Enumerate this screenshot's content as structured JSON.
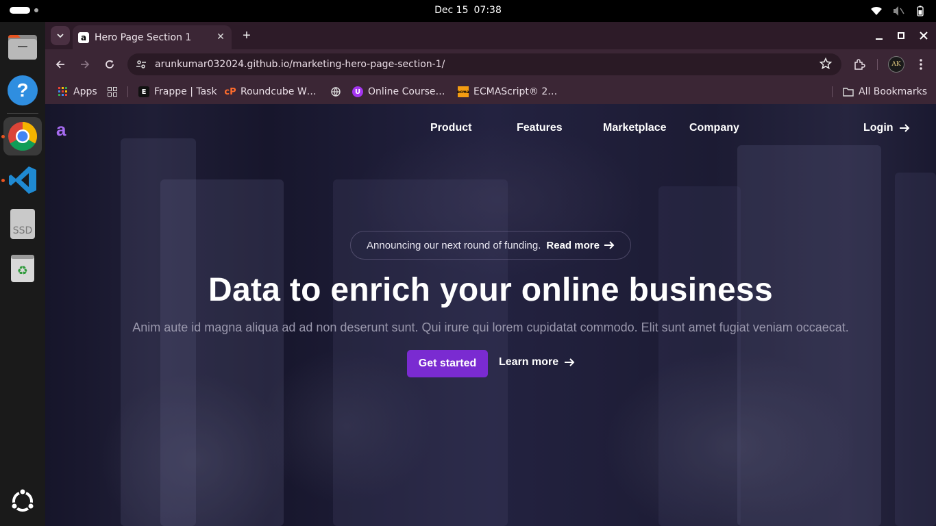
{
  "system": {
    "date": "Dec 15",
    "time": "07:38",
    "tray_icons": [
      "wifi-icon",
      "mute-icon",
      "battery-icon"
    ]
  },
  "dock": {
    "items": [
      "files-icon",
      "help-icon",
      "chrome-icon",
      "vscode-icon",
      "ssd-drive-icon",
      "trash-icon",
      "ubuntu-apps-icon"
    ],
    "ssd_label": "SSD"
  },
  "browser": {
    "tab_title": "Hero Page Section 1",
    "tab_favicon": "a",
    "url": "arunkumar032024.github.io/marketing-hero-page-section-1/",
    "avatar_initials": "AK",
    "bookmarks": {
      "apps": "Apps",
      "frappe": "Frappe | Task",
      "roundcube": "Roundcube W…",
      "online_course": "Online Course…",
      "ecmascript": "ECMAScript® 2…",
      "all_bookmarks": "All Bookmarks"
    }
  },
  "site": {
    "logo": "a",
    "nav": [
      "Product",
      "Features",
      "Marketplace",
      "Company"
    ],
    "login": "Login",
    "announcement": "Announcing our next round of funding.",
    "announcement_link": "Read more",
    "headline": "Data to enrich your online business",
    "subheadline": "Anim aute id magna aliqua ad ad non deserunt sunt. Qui irure qui lorem cupidatat commodo. Elit sunt amet fugiat veniam occaecat.",
    "cta_primary": "Get started",
    "cta_secondary": "Learn more",
    "colors": {
      "accent": "#7a2bd1",
      "logo": "#a66bf0",
      "background": "#1f1e36"
    }
  }
}
